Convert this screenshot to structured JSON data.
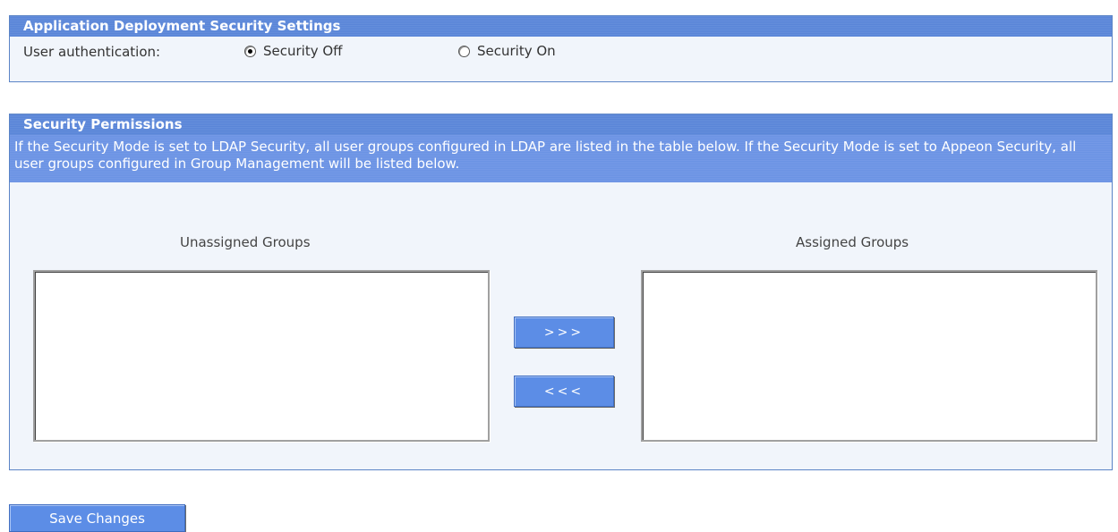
{
  "deployment_panel": {
    "title": "Application Deployment Security Settings",
    "auth_label": "User authentication:",
    "options": [
      {
        "label": "Security Off",
        "checked": true
      },
      {
        "label": "Security On",
        "checked": false
      }
    ]
  },
  "permissions_panel": {
    "title": "Security Permissions",
    "description": "If the Security Mode is set to LDAP Security, all user groups configured in LDAP are listed in the table below.  If the Security Mode is set to Appeon Security, all user groups configured in Group Management will be listed below.",
    "unassigned_label": "Unassigned Groups",
    "assigned_label": "Assigned Groups",
    "unassigned_items": [],
    "assigned_items": [],
    "add_button": ">>>",
    "remove_button": "<<<"
  },
  "save_button": "Save Changes"
}
